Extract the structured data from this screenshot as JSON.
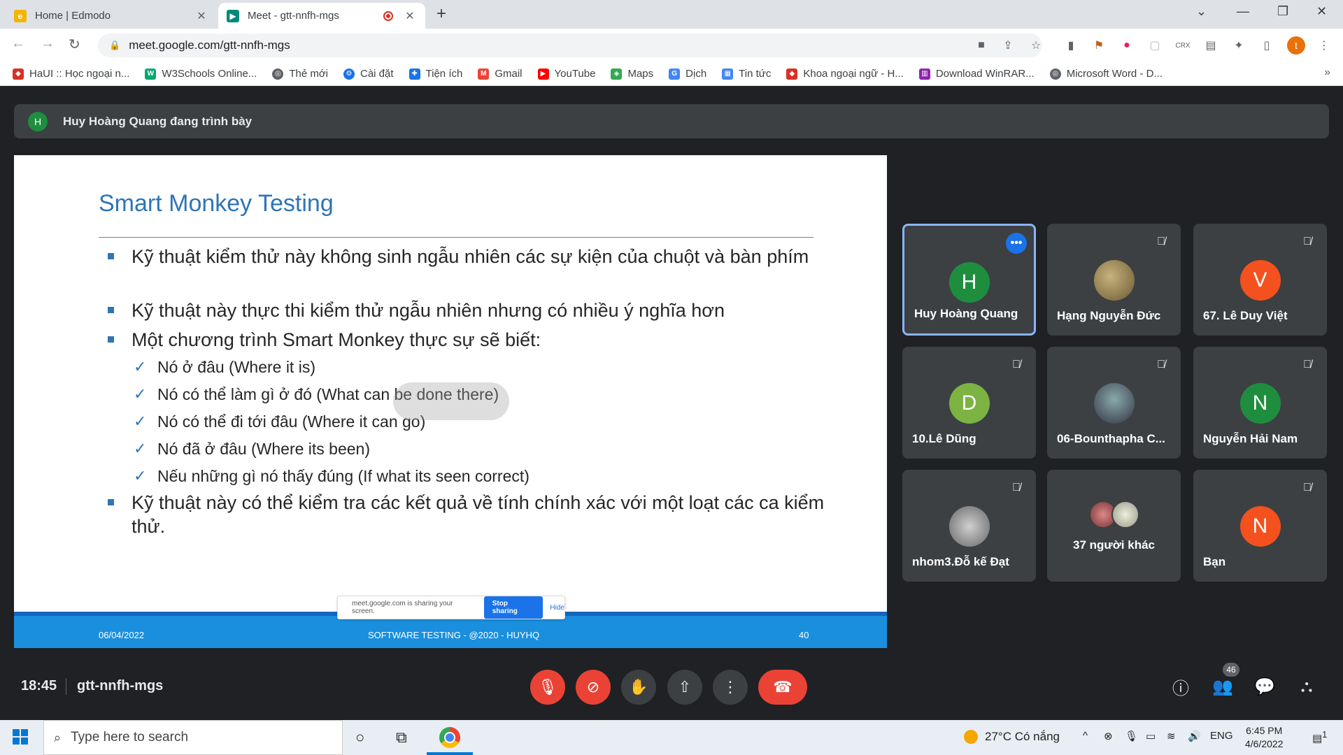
{
  "browser": {
    "tabs": [
      {
        "label": "Home | Edmodo",
        "active": false
      },
      {
        "label": "Meet - gtt-nnfh-mgs",
        "active": true
      }
    ],
    "url": "meet.google.com/gtt-nnfh-mgs",
    "profile_initial": "t",
    "bookmarks": [
      {
        "label": "HaUI :: Học ngoại n...",
        "icon": "haui-icon",
        "color": "#d93025"
      },
      {
        "label": "W3Schools Online...",
        "icon": "w3schools-icon",
        "color": "#04aa6d"
      },
      {
        "label": "Thẻ mới",
        "icon": "globe-icon",
        "color": "#5f6368"
      },
      {
        "label": "Cài đặt",
        "icon": "gear-icon",
        "color": "#1a73e8"
      },
      {
        "label": "Tiện ích",
        "icon": "puzzle-icon",
        "color": "#1a73e8"
      },
      {
        "label": "Gmail",
        "icon": "gmail-icon",
        "color": "#ea4335"
      },
      {
        "label": "YouTube",
        "icon": "youtube-icon",
        "color": "#ff0000"
      },
      {
        "label": "Maps",
        "icon": "maps-icon",
        "color": "#34a853"
      },
      {
        "label": "Dịch",
        "icon": "translate-icon",
        "color": "#4285f4"
      },
      {
        "label": "Tin tức",
        "icon": "news-icon",
        "color": "#4285f4"
      },
      {
        "label": "Khoa ngoại ngữ - H...",
        "icon": "haui-icon",
        "color": "#d93025"
      },
      {
        "label": "Download WinRAR...",
        "icon": "winrar-icon",
        "color": "#8e24aa"
      },
      {
        "label": "Microsoft Word - D...",
        "icon": "globe-icon",
        "color": "#5f6368"
      }
    ]
  },
  "meet": {
    "presenter_initial": "H",
    "presenter_text": "Huy Hoàng Quang đang trình bày",
    "slide": {
      "title": "Smart Monkey Testing",
      "bullets": [
        "Kỹ thuật kiểm thử này không sinh ngẫu nhiên các sự kiện của chuột và bàn phím",
        "Kỹ thuật này thực thi kiểm thử ngẫu nhiên nhưng có nhiều ý nghĩa hơn",
        "Một chương trình Smart Monkey thực sự sẽ biết:"
      ],
      "sub_bullets": [
        "Nó ở đâu (Where it is)",
        "Nó có thể làm gì ở đó (What can be done there)",
        "Nó có thể đi tới đâu (Where it can go)",
        "Nó đã ở đâu (Where its been)",
        "Nếu những gì nó thấy đúng (If what its seen correct)"
      ],
      "last_bullet": "Kỹ thuật này có thể kiểm tra các kết quả về tính chính xác với một loạt các ca kiểm thử.",
      "footer_date": "06/04/2022",
      "footer_center": "SOFTWARE TESTING - @2020 - HUYHQ",
      "footer_page": "40",
      "share_notice": "meet.google.com is sharing your screen.",
      "stop_sharing": "Stop sharing",
      "hide": "Hide"
    },
    "participants": [
      {
        "name": "Huy Hoàng Quang",
        "initial": "H",
        "color": "#1e8e3e",
        "muted": false,
        "speaking": true
      },
      {
        "name": "Hạng Nguyễn Đức",
        "initial": "",
        "color": "",
        "muted": true,
        "photo": "cat-photo"
      },
      {
        "name": "67. Lê Duy Việt",
        "initial": "V",
        "color": "#f4511e",
        "muted": true
      },
      {
        "name": "10.Lê Dũng",
        "initial": "D",
        "color": "#7cb342",
        "muted": true
      },
      {
        "name": "06-Bounthapha C...",
        "initial": "",
        "color": "",
        "muted": true,
        "photo": "person-photo"
      },
      {
        "name": "Nguyễn Hải Nam",
        "initial": "N",
        "color": "#1e8e3e",
        "muted": true
      },
      {
        "name": "nhom3.Đỗ kế Đạt",
        "initial": "",
        "color": "",
        "muted": true,
        "photo": "cat-photo"
      },
      {
        "name": "37 người khác",
        "others": true
      },
      {
        "name": "Bạn",
        "initial": "N",
        "color": "#f4511e",
        "muted": true
      }
    ],
    "clock": "18:45",
    "meeting_code": "gtt-nnfh-mgs",
    "people_count": "46"
  },
  "taskbar": {
    "search_placeholder": "Type here to search",
    "weather": "27°C  Có nắng",
    "language": "ENG",
    "time": "6:45 PM",
    "date": "4/6/2022",
    "notifications": "1"
  }
}
